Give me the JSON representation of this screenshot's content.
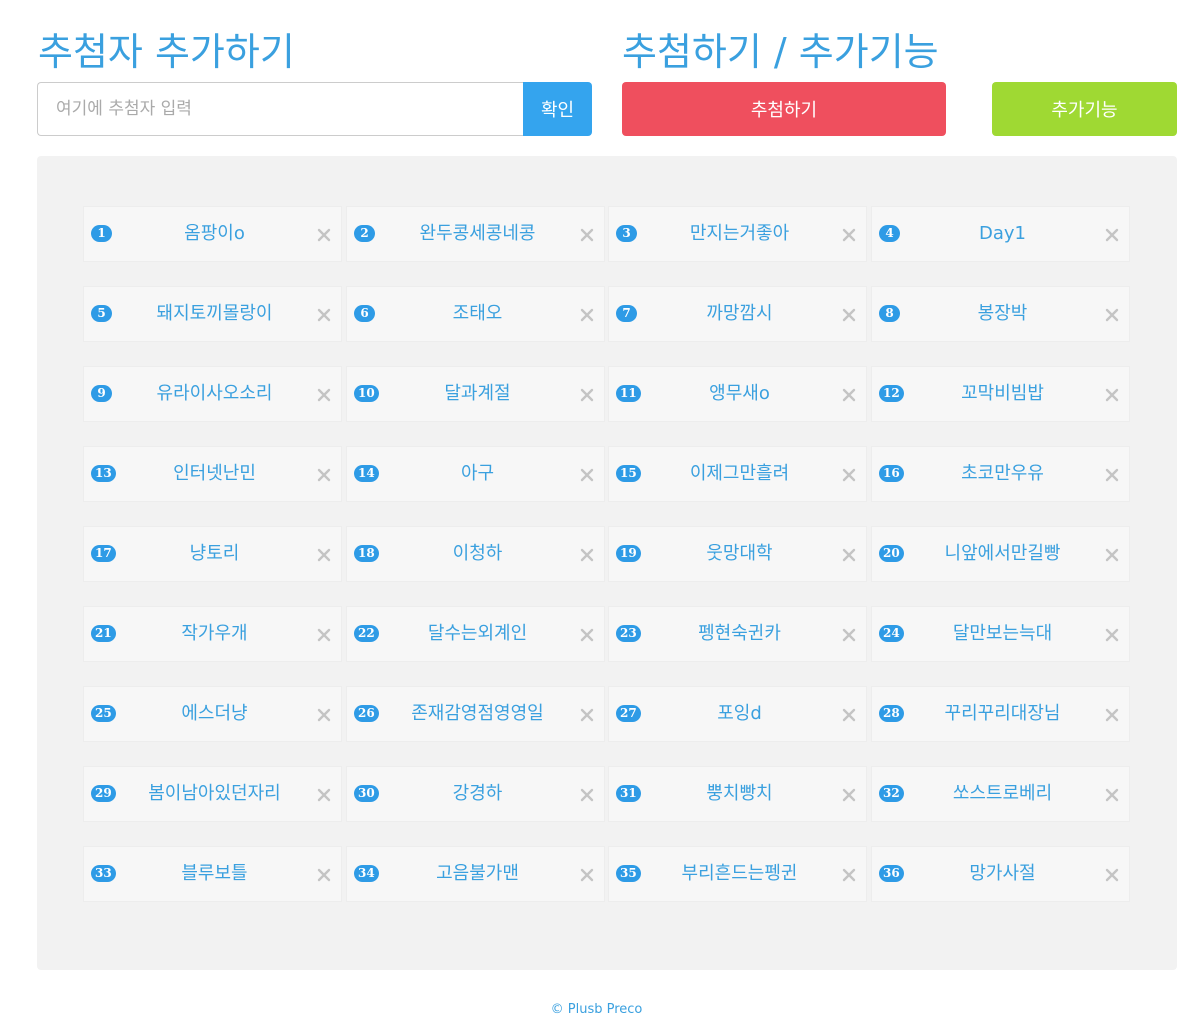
{
  "add_section": {
    "title": "추첨자 추가하기",
    "input_placeholder": "여기에 추첨자 입력",
    "input_value": "",
    "confirm_label": "확인"
  },
  "draw_section": {
    "title": "추첨하기 / 추가기능",
    "draw_label": "추첨하기",
    "extra_label": "추가기능"
  },
  "colors": {
    "accent": "#3aa0df",
    "confirm": "#34a4ee",
    "draw": "#ef4f5e",
    "extra": "#9fd933"
  },
  "remove_icon": "close-icon",
  "entries": [
    {
      "num": "1",
      "name": "옴팡이o"
    },
    {
      "num": "2",
      "name": "완두콩세콩네콩"
    },
    {
      "num": "3",
      "name": "만지는거좋아"
    },
    {
      "num": "4",
      "name": "Day1"
    },
    {
      "num": "5",
      "name": "돼지토끼몰랑이"
    },
    {
      "num": "6",
      "name": "조태오"
    },
    {
      "num": "7",
      "name": "까망깜시"
    },
    {
      "num": "8",
      "name": "봉장박"
    },
    {
      "num": "9",
      "name": "유라이사오소리"
    },
    {
      "num": "10",
      "name": "달과계절"
    },
    {
      "num": "11",
      "name": "앵무새o"
    },
    {
      "num": "12",
      "name": "꼬막비빔밥"
    },
    {
      "num": "13",
      "name": "인터넷난민"
    },
    {
      "num": "14",
      "name": "아구"
    },
    {
      "num": "15",
      "name": "이제그만흘려"
    },
    {
      "num": "16",
      "name": "초코만우유"
    },
    {
      "num": "17",
      "name": "냥토리"
    },
    {
      "num": "18",
      "name": "이청하"
    },
    {
      "num": "19",
      "name": "웃망대학"
    },
    {
      "num": "20",
      "name": "니앞에서만길빵"
    },
    {
      "num": "21",
      "name": "작가우개"
    },
    {
      "num": "22",
      "name": "달수는외계인"
    },
    {
      "num": "23",
      "name": "펭현숙귄카"
    },
    {
      "num": "24",
      "name": "달만보는늑대"
    },
    {
      "num": "25",
      "name": "에스더냥"
    },
    {
      "num": "26",
      "name": "존재감영점영영일"
    },
    {
      "num": "27",
      "name": "포잉d"
    },
    {
      "num": "28",
      "name": "꾸리꾸리대장님"
    },
    {
      "num": "29",
      "name": "봄이남아있던자리"
    },
    {
      "num": "30",
      "name": "강경하"
    },
    {
      "num": "31",
      "name": "뿡치빵치"
    },
    {
      "num": "32",
      "name": "쏘스트로베리"
    },
    {
      "num": "33",
      "name": "블루보틀"
    },
    {
      "num": "34",
      "name": "고음불가맨"
    },
    {
      "num": "35",
      "name": "부리흔드는펭귄"
    },
    {
      "num": "36",
      "name": "망가사절"
    }
  ],
  "footer": "© Plusb Preco"
}
